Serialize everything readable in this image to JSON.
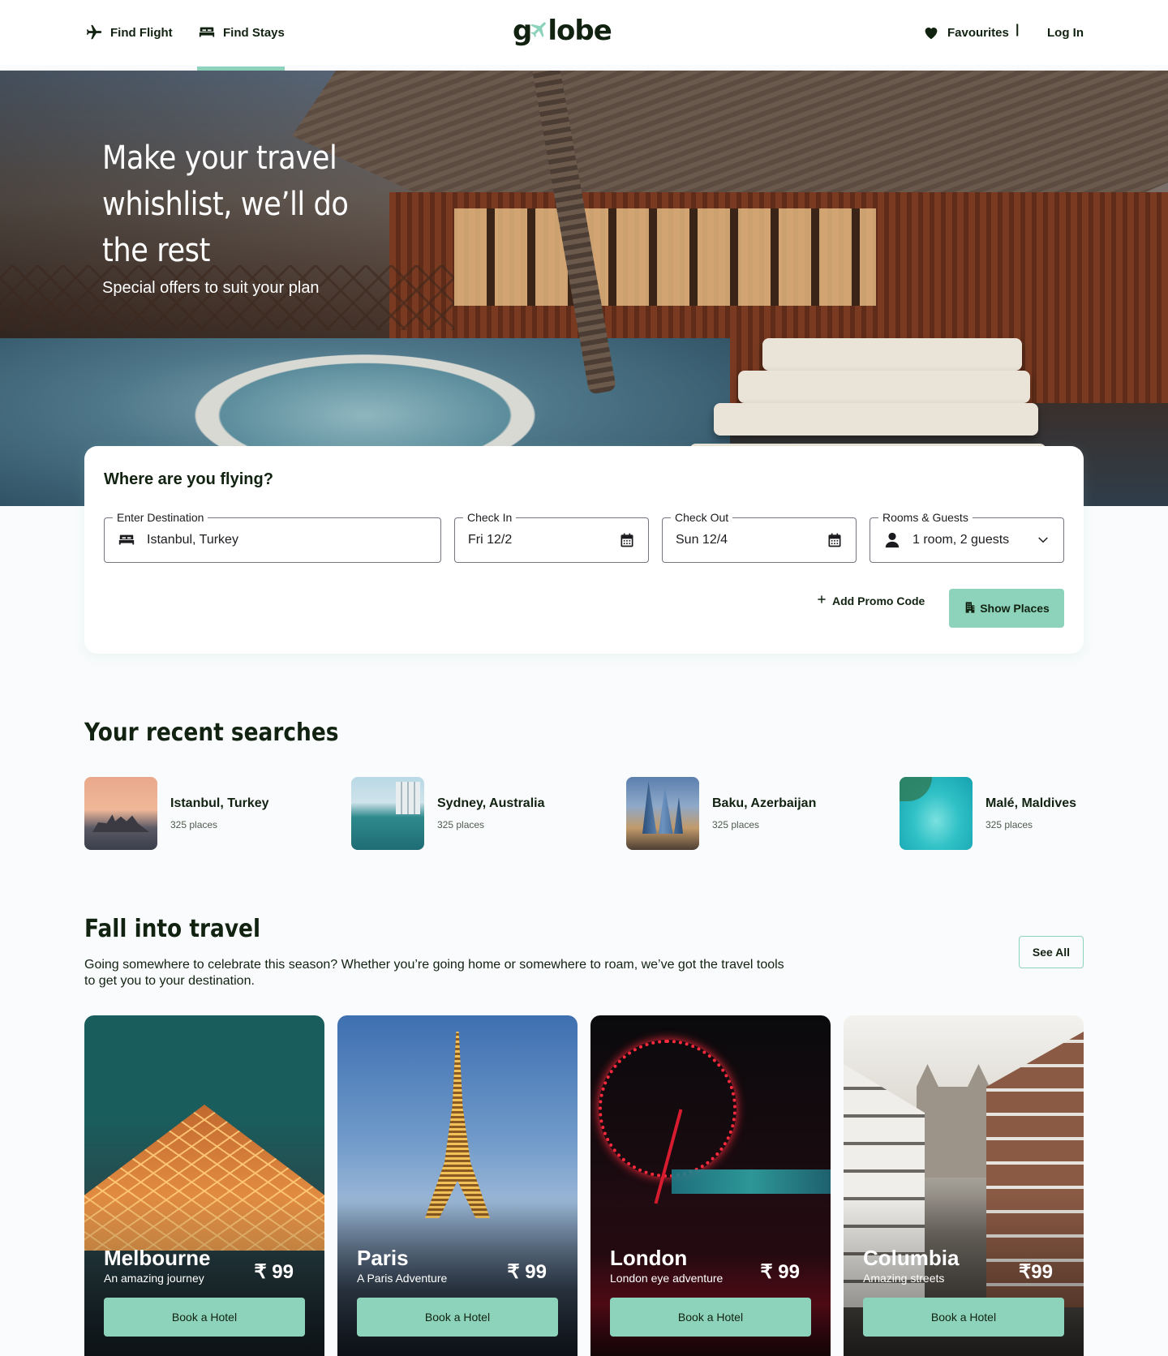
{
  "nav": {
    "find_flight": "Find Flight",
    "find_stays": "Find Stays",
    "logo": {
      "left": "g",
      "right": "lobe"
    },
    "favourites": "Favourites",
    "separator": "|",
    "login": "Log In"
  },
  "hero": {
    "title": "Make your travel whishlist, we’ll do the rest",
    "subtitle": "Special offers to suit your plan"
  },
  "search": {
    "title": "Where are you flying?",
    "destination": {
      "label": "Enter Destination",
      "value": "Istanbul, Turkey"
    },
    "check_in": {
      "label": "Check In",
      "value": "Fri 12/2"
    },
    "check_out": {
      "label": "Check Out",
      "value": "Sun 12/4"
    },
    "guests": {
      "label": "Rooms & Guests",
      "value": "1 room, 2 guests"
    },
    "promo": "Add Promo Code",
    "show_places": "Show Places"
  },
  "recent": {
    "title": "Your recent searches",
    "items": [
      {
        "name": "Istanbul, Turkey",
        "count": "325 places"
      },
      {
        "name": "Sydney, Australia",
        "count": "325 places"
      },
      {
        "name": "Baku, Azerbaijan",
        "count": "325 places"
      },
      {
        "name": "Malé, Maldives",
        "count": "325 places"
      }
    ]
  },
  "fall": {
    "title": "Fall into travel",
    "description": "Going somewhere to celebrate this season? Whether you’re going home or somewhere to roam, we’ve got the travel tools to get you to your destination.",
    "see_all": "See All",
    "cards": [
      {
        "name": "Melbourne",
        "tagline": "An amazing journey",
        "price": "₹ 99",
        "button": "Book a Hotel"
      },
      {
        "name": "Paris",
        "tagline": "A Paris Adventure",
        "price": "₹ 99",
        "button": "Book a Hotel"
      },
      {
        "name": "London",
        "tagline": "London eye adventure",
        "price": "₹ 99",
        "button": "Book a Hotel"
      },
      {
        "name": "Columbia",
        "tagline": "Amazing streets",
        "price": "₹99",
        "button": "Book a Hotel"
      }
    ]
  },
  "colors": {
    "accent": "#8DD3BB",
    "text": "#112211",
    "background": "#FAFBFC"
  },
  "icons": [
    "airplane-icon",
    "bed-icon",
    "heart-icon",
    "calendar-icon",
    "person-icon",
    "chevron-down-icon",
    "plus-icon",
    "building-icon"
  ]
}
